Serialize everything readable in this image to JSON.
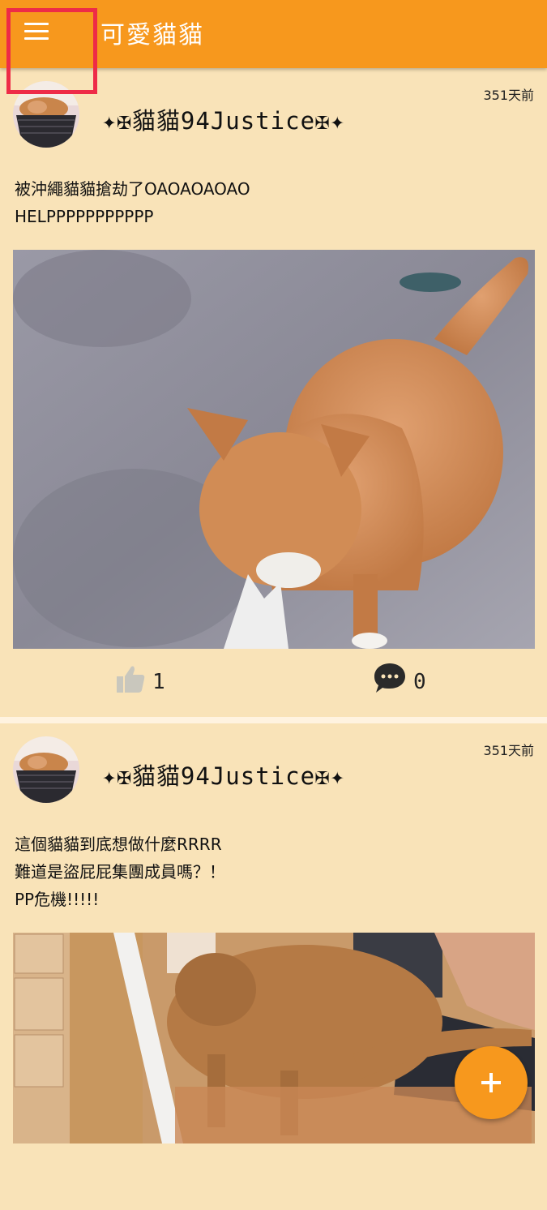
{
  "appbar": {
    "title": "可愛貓貓",
    "menu_icon": "hamburger-menu-icon"
  },
  "posts": [
    {
      "username": "✦✠貓貓94Justice✠✦",
      "time": "351天前",
      "text": "被沖繩貓貓搶劫了OAOAOAOAO\nHELPPPPPPPPPPP",
      "likes": "1",
      "comments": "0"
    },
    {
      "username": "✦✠貓貓94Justice✠✦",
      "time": "351天前",
      "text": "這個貓貓到底想做什麼RRRR\n難道是盜屁屁集團成員嗎？！\nPP危機!!!!!"
    }
  ],
  "fab": {
    "icon": "plus-icon"
  },
  "colors": {
    "primary": "#f7981d",
    "background": "#f9e3b8",
    "highlight": "#ee2b47"
  }
}
